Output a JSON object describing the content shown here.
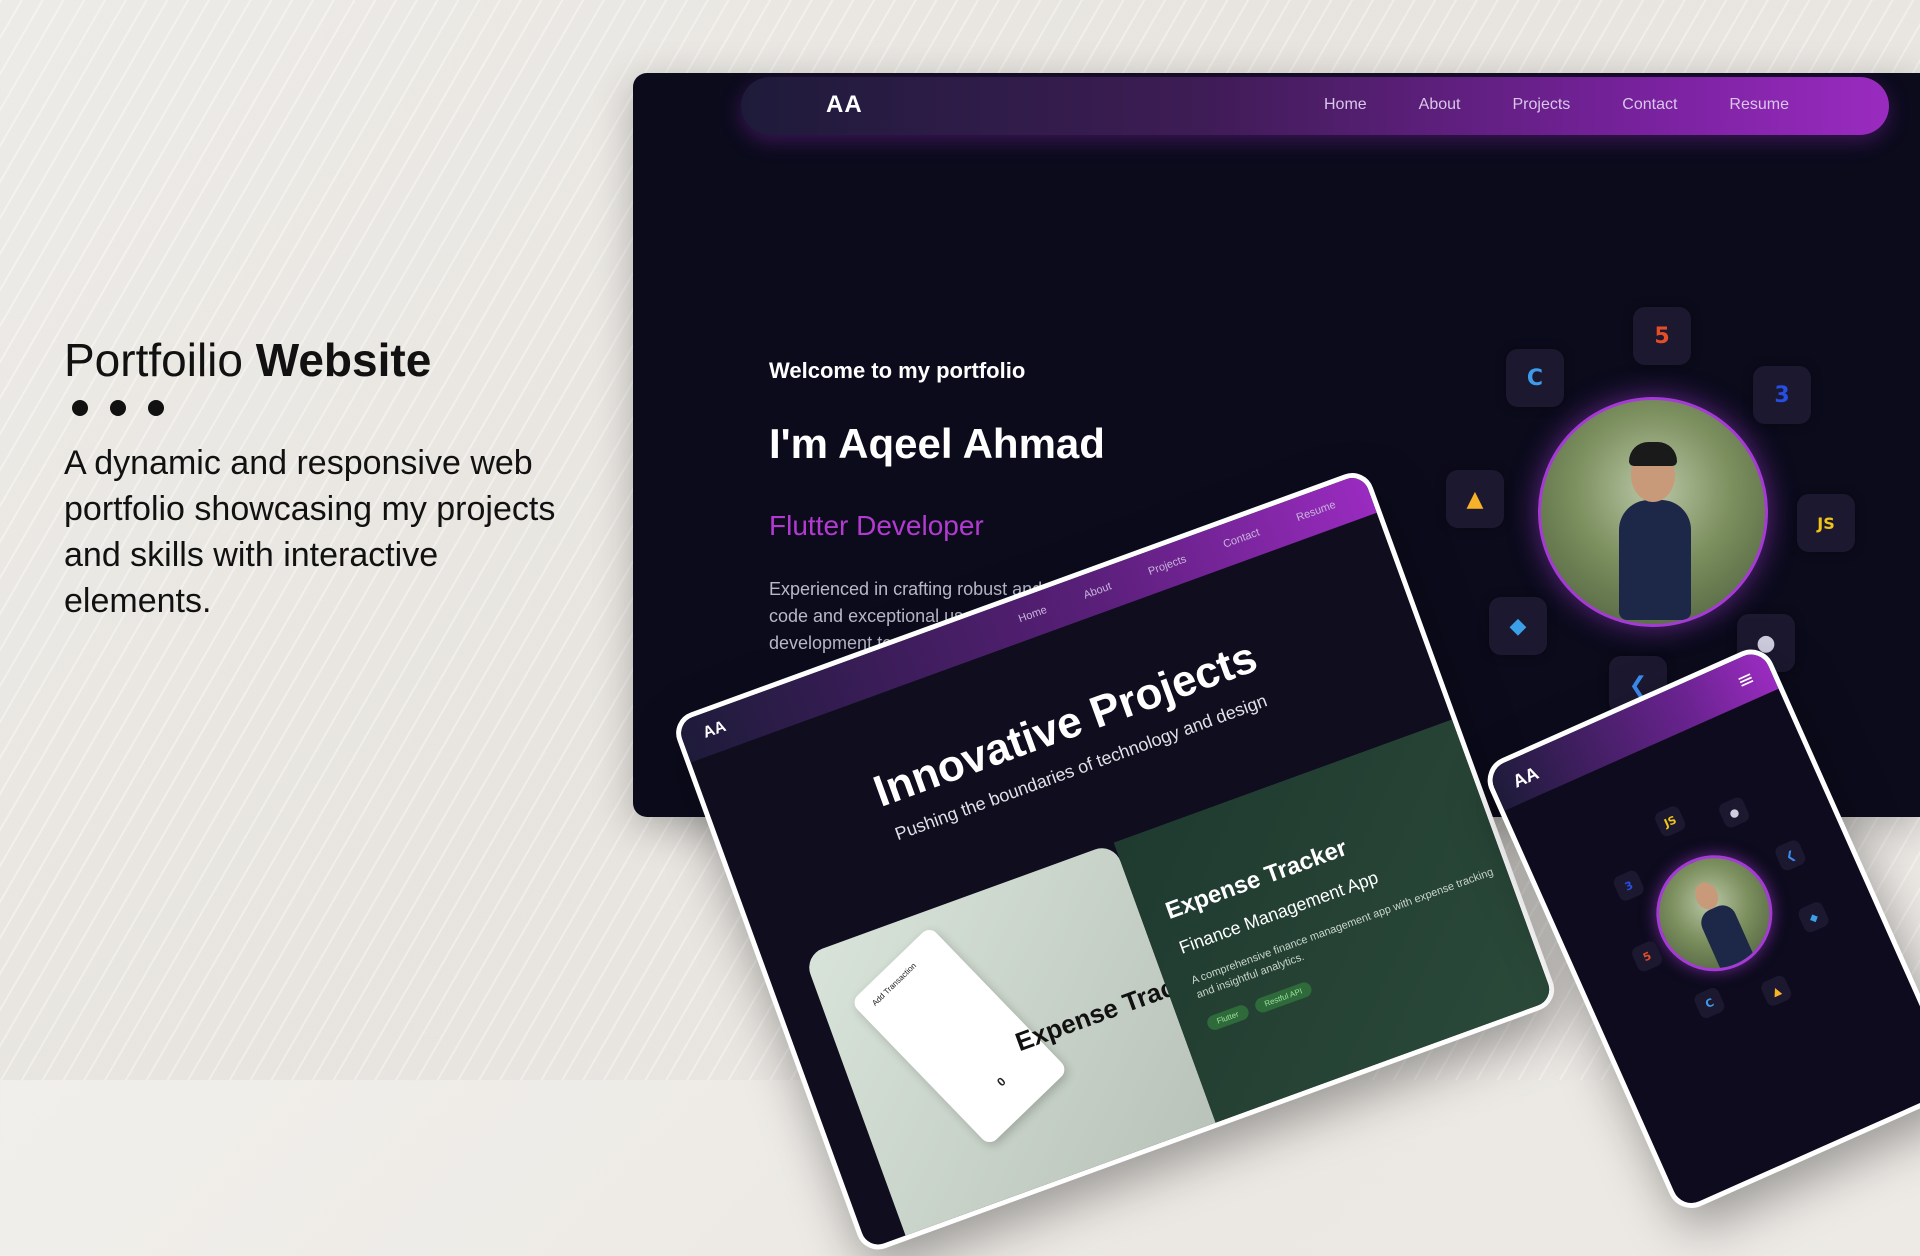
{
  "left": {
    "title_light": "Portfoilio",
    "title_bold": "Website",
    "description": "A dynamic and responsive web portfolio showcasing my projects and skills with interactive elements."
  },
  "desktop": {
    "nav": {
      "logo": "AA",
      "links": [
        "Home",
        "About",
        "Projects",
        "Contact",
        "Resume"
      ]
    },
    "hero": {
      "welcome": "Welcome to my portfolio",
      "name": "I'm Aqeel Ahmad",
      "role": "Flutter Developer",
      "about": "Experienced in crafting robust and scalable applications with a focus on clean code and exceptional user experiences. Specializing in web and mobile development technologies."
    },
    "skill_icons": [
      {
        "name": "html5-icon",
        "glyph": "5",
        "color": "#e44d26"
      },
      {
        "name": "css3-icon",
        "glyph": "3",
        "color": "#264de4"
      },
      {
        "name": "javascript-icon",
        "glyph": "JS",
        "color": "#f0c419"
      },
      {
        "name": "github-icon",
        "glyph": "●",
        "color": "#cfcfe0"
      },
      {
        "name": "flutter-icon",
        "glyph": "❮",
        "color": "#3b8cf0"
      },
      {
        "name": "dart-icon",
        "glyph": "◆",
        "color": "#3aa0e8"
      },
      {
        "name": "firebase-icon",
        "glyph": "▲",
        "color": "#f7b22a"
      },
      {
        "name": "cpp-icon",
        "glyph": "C",
        "color": "#3e9be9"
      }
    ]
  },
  "tablet": {
    "logo": "AA",
    "links": [
      "Home",
      "About",
      "Projects",
      "Contact",
      "Resume"
    ],
    "headline": "Innovative Projects",
    "subheadline": "Pushing the boundaries of technology and design",
    "card_left_title": "Expense Tracker",
    "phone_screen_title": "Add Transaction",
    "phone_screen_value": "0",
    "card_right_title": "Expense Tracker",
    "card_right_subtitle": "Finance Management App",
    "card_right_desc": "A comprehensive finance management app with expense tracking and insightful analytics.",
    "chips": [
      "Flutter",
      "Restful API"
    ]
  },
  "phone": {
    "logo": "AA",
    "menu_icon": "≡"
  },
  "colors": {
    "accent": "#a53ad6",
    "role_text": "#b23ad0",
    "desktop_bg": "#0b0b1c"
  }
}
